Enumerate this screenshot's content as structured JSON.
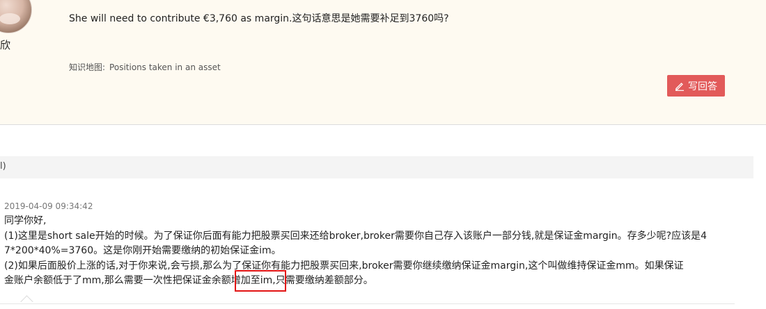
{
  "question": {
    "user_name": "欣",
    "text": "She will need to contribute €3,760 as margin.这句话意思是她需要补足到3760吗?",
    "knowledge_map_label": "知识地图:",
    "knowledge_map_value": "Positions taken in an asset",
    "answer_button_label": "写回答",
    "accent_color": "#e25a5a"
  },
  "section_bar": {
    "label": "l)"
  },
  "answer": {
    "timestamp": "2019-04-09 09:34:42",
    "lines": [
      "同学你好,",
      "(1)这里是short sale开始的时候。为了保证你后面有能力把股票买回来还给broker,broker需要你自己存入该账户一部分钱,就是保证金margin。存多少呢?应该是4",
      "7*200*40%=3760。这是你刚开始需要缴纳的初始保证金im。",
      "(2)如果后面股价上涨的话,对于你来说,会亏损,那么为了保证你有能力把股票买回来,broker需要你继续缴纳保证金margin,这个叫做维持保证金mm。如果保证",
      "金账户余额低于了mm,那么需要一次性把保证金余额增加至im,只需要缴纳差额部分。"
    ],
    "highlight_color": "#e21313"
  }
}
